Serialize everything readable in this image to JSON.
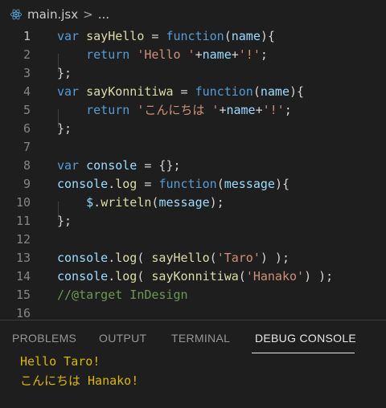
{
  "breadcrumb": {
    "file_icon": "react-icon",
    "filename": "main.jsx",
    "separator": ">",
    "more": "..."
  },
  "editor": {
    "active_line": 1,
    "lines": [
      {
        "num": "1",
        "tokens": [
          {
            "t": "var",
            "c": "k"
          },
          {
            "t": " ",
            "c": "p"
          },
          {
            "t": "sayHello",
            "c": "f"
          },
          {
            "t": " = ",
            "c": "p"
          },
          {
            "t": "function",
            "c": "k"
          },
          {
            "t": "(",
            "c": "p"
          },
          {
            "t": "name",
            "c": "v"
          },
          {
            "t": "){",
            "c": "p"
          }
        ]
      },
      {
        "num": "2",
        "tokens": [
          {
            "t": "    ",
            "c": "p"
          },
          {
            "t": "return",
            "c": "k"
          },
          {
            "t": " ",
            "c": "p"
          },
          {
            "t": "'Hello '",
            "c": "s"
          },
          {
            "t": "+",
            "c": "p"
          },
          {
            "t": "name",
            "c": "v"
          },
          {
            "t": "+",
            "c": "p"
          },
          {
            "t": "'!'",
            "c": "s"
          },
          {
            "t": ";",
            "c": "p"
          }
        ]
      },
      {
        "num": "3",
        "tokens": [
          {
            "t": "};",
            "c": "p"
          }
        ]
      },
      {
        "num": "4",
        "tokens": [
          {
            "t": "var",
            "c": "k"
          },
          {
            "t": " ",
            "c": "p"
          },
          {
            "t": "sayKonnitiwa",
            "c": "f"
          },
          {
            "t": " = ",
            "c": "p"
          },
          {
            "t": "function",
            "c": "k"
          },
          {
            "t": "(",
            "c": "p"
          },
          {
            "t": "name",
            "c": "v"
          },
          {
            "t": "){",
            "c": "p"
          }
        ]
      },
      {
        "num": "5",
        "tokens": [
          {
            "t": "    ",
            "c": "p"
          },
          {
            "t": "return",
            "c": "k"
          },
          {
            "t": " ",
            "c": "p"
          },
          {
            "t": "'こんにちは '",
            "c": "s"
          },
          {
            "t": "+",
            "c": "p"
          },
          {
            "t": "name",
            "c": "v"
          },
          {
            "t": "+",
            "c": "p"
          },
          {
            "t": "'!'",
            "c": "s"
          },
          {
            "t": ";",
            "c": "p"
          }
        ]
      },
      {
        "num": "6",
        "tokens": [
          {
            "t": "};",
            "c": "p"
          }
        ]
      },
      {
        "num": "7",
        "tokens": []
      },
      {
        "num": "8",
        "tokens": [
          {
            "t": "var",
            "c": "k"
          },
          {
            "t": " ",
            "c": "p"
          },
          {
            "t": "console",
            "c": "v"
          },
          {
            "t": " = {};",
            "c": "p"
          }
        ]
      },
      {
        "num": "9",
        "tokens": [
          {
            "t": "console",
            "c": "v"
          },
          {
            "t": ".",
            "c": "p"
          },
          {
            "t": "log",
            "c": "f"
          },
          {
            "t": " = ",
            "c": "p"
          },
          {
            "t": "function",
            "c": "k"
          },
          {
            "t": "(",
            "c": "p"
          },
          {
            "t": "message",
            "c": "v"
          },
          {
            "t": "){",
            "c": "p"
          }
        ]
      },
      {
        "num": "10",
        "tokens": [
          {
            "t": "    ",
            "c": "p"
          },
          {
            "t": "$",
            "c": "v"
          },
          {
            "t": ".",
            "c": "p"
          },
          {
            "t": "writeln",
            "c": "f"
          },
          {
            "t": "(",
            "c": "p"
          },
          {
            "t": "message",
            "c": "v"
          },
          {
            "t": ");",
            "c": "p"
          }
        ]
      },
      {
        "num": "11",
        "tokens": [
          {
            "t": "};",
            "c": "p"
          }
        ]
      },
      {
        "num": "12",
        "tokens": []
      },
      {
        "num": "13",
        "tokens": [
          {
            "t": "console",
            "c": "v"
          },
          {
            "t": ".",
            "c": "p"
          },
          {
            "t": "log",
            "c": "f"
          },
          {
            "t": "( ",
            "c": "p"
          },
          {
            "t": "sayHello",
            "c": "f"
          },
          {
            "t": "(",
            "c": "p"
          },
          {
            "t": "'Taro'",
            "c": "s"
          },
          {
            "t": ") );",
            "c": "p"
          }
        ]
      },
      {
        "num": "14",
        "tokens": [
          {
            "t": "console",
            "c": "v"
          },
          {
            "t": ".",
            "c": "p"
          },
          {
            "t": "log",
            "c": "f"
          },
          {
            "t": "( ",
            "c": "p"
          },
          {
            "t": "sayKonnitiwa",
            "c": "f"
          },
          {
            "t": "(",
            "c": "p"
          },
          {
            "t": "'Hanako'",
            "c": "s"
          },
          {
            "t": ") );",
            "c": "p"
          }
        ]
      },
      {
        "num": "15",
        "tokens": [
          {
            "t": "//@target InDesign",
            "c": "c"
          }
        ]
      },
      {
        "num": "16",
        "tokens": []
      }
    ]
  },
  "panel": {
    "tabs": [
      {
        "label": "PROBLEMS",
        "active": false
      },
      {
        "label": "OUTPUT",
        "active": false
      },
      {
        "label": "TERMINAL",
        "active": false
      },
      {
        "label": "DEBUG CONSOLE",
        "active": true
      }
    ],
    "console_output": [
      "Hello Taro!",
      "こんにちは Hanako!"
    ]
  },
  "colors": {
    "background": "#1e1e1e",
    "keyword": "#569cd6",
    "function": "#dcdcaa",
    "variable": "#9cdcfe",
    "string": "#ce9178",
    "comment": "#6a9955",
    "console_text": "#dcb800"
  }
}
